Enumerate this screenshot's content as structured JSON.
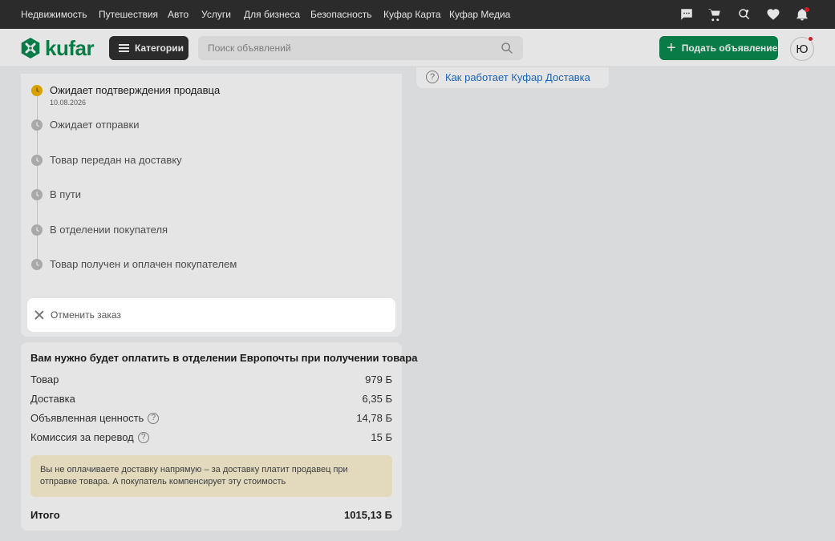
{
  "topnav": {
    "links": [
      "Недвижимость",
      "Путешествия",
      "Авто",
      "Услуги",
      "Для бизнеса",
      "Безопасность",
      "Куфар Карта",
      "Куфар Медиа"
    ],
    "icons": [
      "chat-icon",
      "cart-icon",
      "search-heart-icon",
      "heart-icon",
      "bell-icon"
    ]
  },
  "header": {
    "logo_text": "kufar",
    "categories_label": "Категории",
    "search_placeholder": "Поиск объявлений",
    "post_ad_label": "Подать объявление",
    "avatar_letter": "Ю"
  },
  "status": {
    "steps": [
      {
        "label": "Ожидает подтверждения продавца",
        "date": "10.08.2026",
        "active": true
      },
      {
        "label": "Ожидает отправки",
        "active": false
      },
      {
        "label": "Товар передан на доставку",
        "active": false
      },
      {
        "label": "В пути",
        "active": false
      },
      {
        "label": "В отделении покупателя",
        "active": false
      },
      {
        "label": "Товар получен и оплачен покупателем",
        "active": false
      }
    ],
    "cancel_label": "Отменить заказ"
  },
  "payment": {
    "title": "Вам нужно будет оплатить в отделении Европочты при получении товара",
    "rows": [
      {
        "label": "Товар",
        "value": "979 Б",
        "help": false
      },
      {
        "label": "Доставка",
        "value": "6,35 Б",
        "help": false
      },
      {
        "label": "Объявленная ценность",
        "value": "14,78 Б",
        "help": true
      },
      {
        "label": "Комиссия за перевод",
        "value": "15 Б",
        "help": true
      }
    ],
    "notice": "Вы не оплачиваете доставку напрямую – за доставку платит продавец при отправке товара. А покупатель компенсирует эту стоимость",
    "total_label": "Итого",
    "total_value": "1015,13 Б"
  },
  "help": {
    "link_label": "Как работает Куфар Доставка",
    "icon_glyph": "?"
  },
  "colors": {
    "brand_green": "#0a8a4f",
    "active_step": "#f0b400",
    "overlay": "rgba(0,0,0,0.1)"
  }
}
